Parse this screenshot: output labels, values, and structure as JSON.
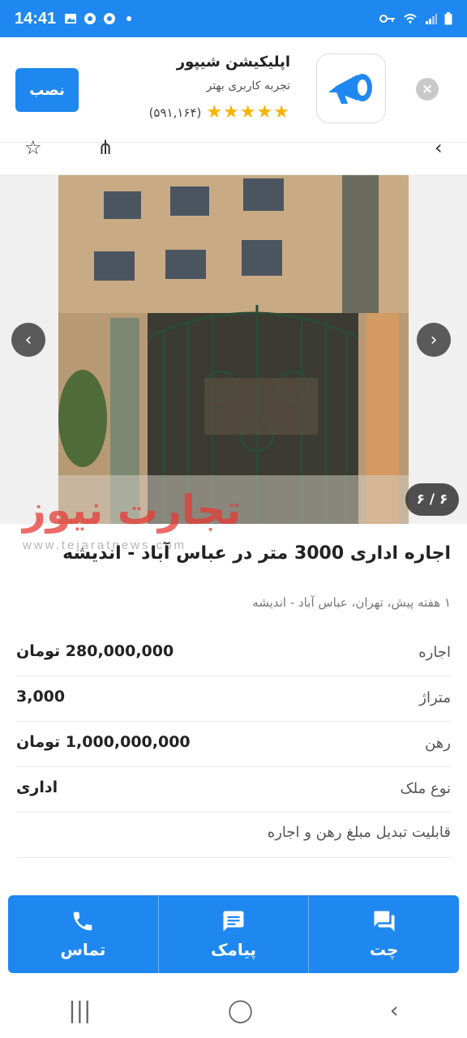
{
  "status": {
    "time": "14:41",
    "left_icons": [
      "image-icon",
      "chrome-icon",
      "chrome-icon",
      "dot-icon"
    ],
    "right_icons": [
      "key-icon",
      "wifi-icon",
      "signal-icon",
      "battery-icon"
    ]
  },
  "banner": {
    "install_label": "نصب",
    "app_name": "اپلیکیشن شیپور",
    "tagline": "تجربه کاربری بهتر",
    "stars": "★★★★★",
    "rating_count": "(۵۹۱,۱۶۴)",
    "accent": "#1e88f0"
  },
  "gallery": {
    "counter": "۶ / ۶",
    "prev_icon": "chevron-left-icon",
    "next_icon": "chevron-right-icon",
    "watermark_brand": "تجارت نیوز",
    "watermark_url": "www.tejaratnews.com"
  },
  "listing": {
    "title": "اجاره اداری 3000 متر در عباس آباد - اندیشه",
    "meta": "۱ هفته پیش، تهران، عباس آباد - اندیشه",
    "rows": [
      {
        "label": "اجاره",
        "value": "280,000,000 تومان"
      },
      {
        "label": "متراژ",
        "value": "3,000"
      },
      {
        "label": "رهن",
        "value": "1,000,000,000 تومان"
      },
      {
        "label": "نوع ملک",
        "value": "اداری"
      }
    ],
    "note": "قابلیت تبدیل مبلغ رهن و اجاره"
  },
  "actions": {
    "call_label": "تماس",
    "sms_label": "پیامک",
    "chat_label": "چت"
  }
}
